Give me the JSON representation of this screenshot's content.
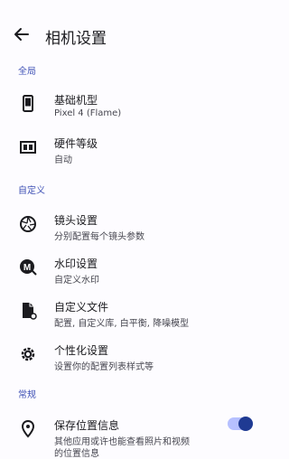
{
  "header": {
    "title": "相机设置"
  },
  "sections": {
    "general": "全局",
    "custom": "自定义",
    "common": "常规"
  },
  "items": {
    "model": {
      "label": "基础机型",
      "sub": "Pixel 4 (Flame)"
    },
    "hardware": {
      "label": "硬件等级",
      "sub": "自动"
    },
    "lens": {
      "label": "镜头设置",
      "sub": "分别配置每个镜头参数"
    },
    "watermark": {
      "label": "水印设置",
      "sub": "自定义水印"
    },
    "customfile": {
      "label": "自定义文件",
      "sub": "配置, 自定义库, 白平衡, 降噪模型"
    },
    "personal": {
      "label": "个性化设置",
      "sub": "设置你的配置列表样式等"
    },
    "location": {
      "label": "保存位置信息",
      "sub": "其他应用或许也能查看照片和视频",
      "sub2": "的位置信息",
      "enabled": true
    }
  },
  "colors": {
    "accent": "#3f51b5",
    "toggle_track": "#b6c0ff",
    "toggle_knob": "#1f3a93"
  }
}
